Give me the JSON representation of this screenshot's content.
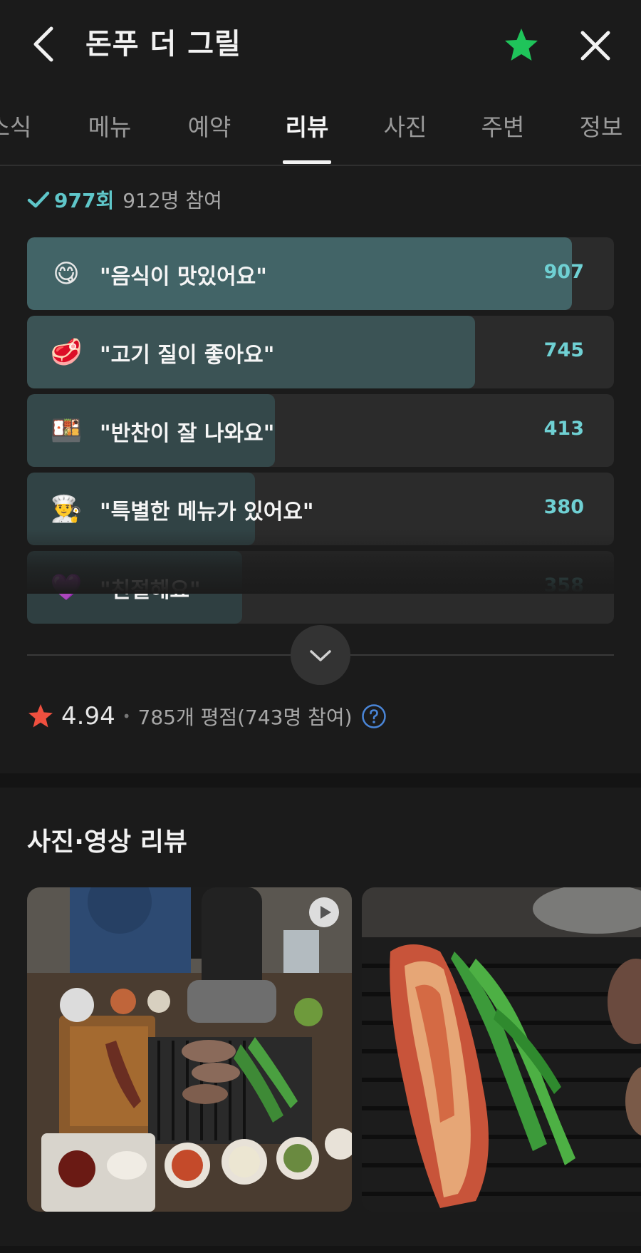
{
  "header": {
    "title": "돈푸 더 그릴",
    "back_icon": "chevron-left-icon",
    "favorite_icon": "star-icon",
    "favorite_color": "#1fc45a",
    "close_icon": "close-icon"
  },
  "tabs": [
    {
      "label": "소식",
      "active": false
    },
    {
      "label": "메뉴",
      "active": false
    },
    {
      "label": "예약",
      "active": false
    },
    {
      "label": "리뷰",
      "active": true
    },
    {
      "label": "사진",
      "active": false
    },
    {
      "label": "주변",
      "active": false
    },
    {
      "label": "정보",
      "active": false
    }
  ],
  "summary": {
    "count": "977회",
    "participants": "912명 참여"
  },
  "votes": [
    {
      "emoji": "😋",
      "label": "\"음식이 맛있어요\"",
      "count": "907",
      "fill_fraction": 0.928,
      "fill_color": "#426467"
    },
    {
      "emoji": "🥩",
      "label": "\"고기 질이 좋아요\"",
      "count": "745",
      "fill_fraction": 0.763,
      "fill_color": "#3b5355"
    },
    {
      "emoji": "🍱",
      "label": "\"반찬이 잘 나와요\"",
      "count": "413",
      "fill_fraction": 0.422,
      "fill_color": "#34484a"
    },
    {
      "emoji": "👨‍🍳",
      "label": "\"특별한 메뉴가 있어요\"",
      "count": "380",
      "fill_fraction": 0.388,
      "fill_color": "#314345"
    },
    {
      "emoji": "💜",
      "label": "\"친절해요\"",
      "count": "358",
      "fill_fraction": 0.366,
      "fill_color": "#2f3f41"
    }
  ],
  "expand_icon": "chevron-down-icon",
  "rating": {
    "score": "4.94",
    "separator": "•",
    "text": "785개 평점(743명 참여)",
    "star_color": "#f0503f",
    "help_icon": "question-circle-icon"
  },
  "photo_section": {
    "title": "사진·영상 리뷰",
    "play_icon": "play-icon"
  },
  "colors": {
    "background": "#1b1b1b",
    "accent": "#5fc6c9"
  }
}
